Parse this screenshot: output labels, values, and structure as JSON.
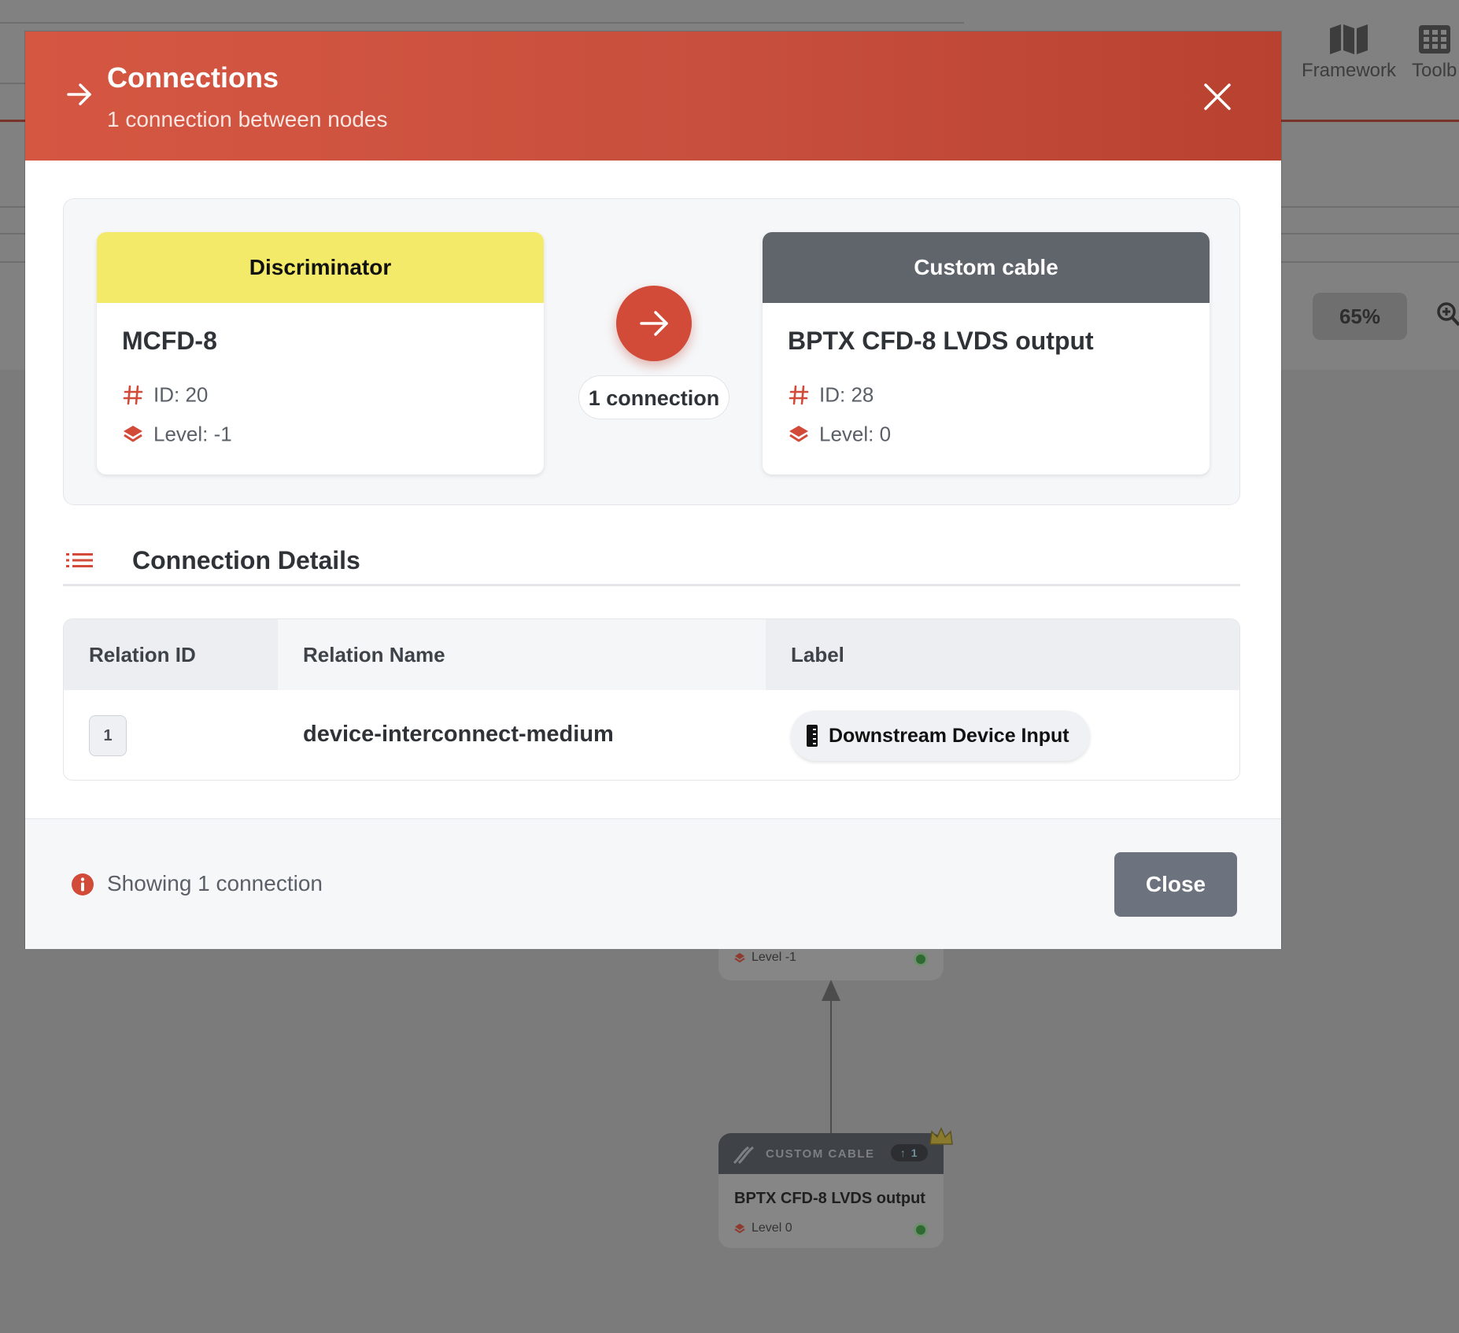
{
  "background": {
    "toolbar": {
      "framework_label": "Framework",
      "toolbox_label": "Toolb",
      "zoom": "65%"
    },
    "nodes": [
      {
        "level_text": "Level -1"
      },
      {
        "type_label": "CUSTOM CABLE",
        "count_badge": "↑ 1",
        "title": "BPTX CFD-8 LVDS output",
        "level_text": "Level 0"
      }
    ]
  },
  "modal": {
    "title": "Connections",
    "subtitle": "1 connection between nodes",
    "source": {
      "type": "Discriminator",
      "name": "MCFD-8",
      "id_text": "ID: 20",
      "level_text": "Level: -1",
      "header_color": "#f4ea6a"
    },
    "target": {
      "type": "Custom cable",
      "name": "BPTX CFD-8 LVDS output",
      "id_text": "ID: 28",
      "level_text": "Level: 0",
      "header_color": "#60646b"
    },
    "connection_count": "1 connection",
    "details_title": "Connection Details",
    "table": {
      "headers": [
        "Relation ID",
        "Relation Name",
        "Label"
      ],
      "rows": [
        {
          "id": "1",
          "name": "device-interconnect-medium",
          "label": "Downstream Device Input"
        }
      ]
    },
    "footer": {
      "info_text": "Showing 1 connection",
      "close_label": "Close"
    }
  },
  "colors": {
    "accent": "#d14b38",
    "close_button": "#6c737e"
  }
}
